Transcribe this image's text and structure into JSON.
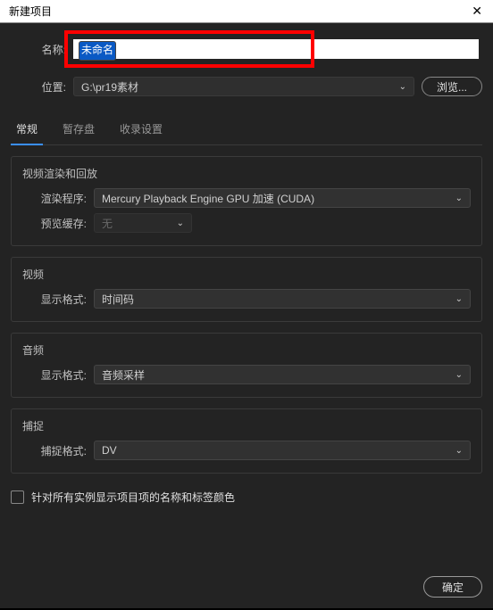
{
  "window": {
    "title": "新建项目"
  },
  "name": {
    "label": "名称:",
    "value": "未命名"
  },
  "location": {
    "label": "位置:",
    "value": "G:\\pr19素材",
    "browse": "浏览..."
  },
  "tabs": {
    "general": "常规",
    "scratch": "暂存盘",
    "ingest": "收录设置"
  },
  "render": {
    "section": "视频渲染和回放",
    "renderer_label": "渲染程序:",
    "renderer_value": "Mercury Playback Engine GPU 加速 (CUDA)",
    "preview_label": "预览缓存:",
    "preview_value": "无"
  },
  "video": {
    "section": "视频",
    "display_label": "显示格式:",
    "display_value": "时间码"
  },
  "audio": {
    "section": "音频",
    "display_label": "显示格式:",
    "display_value": "音频采样"
  },
  "capture": {
    "section": "捕捉",
    "format_label": "捕捉格式:",
    "format_value": "DV"
  },
  "checkbox": {
    "label": "针对所有实例显示项目项的名称和标签颜色"
  },
  "footer": {
    "ok": "确定"
  }
}
